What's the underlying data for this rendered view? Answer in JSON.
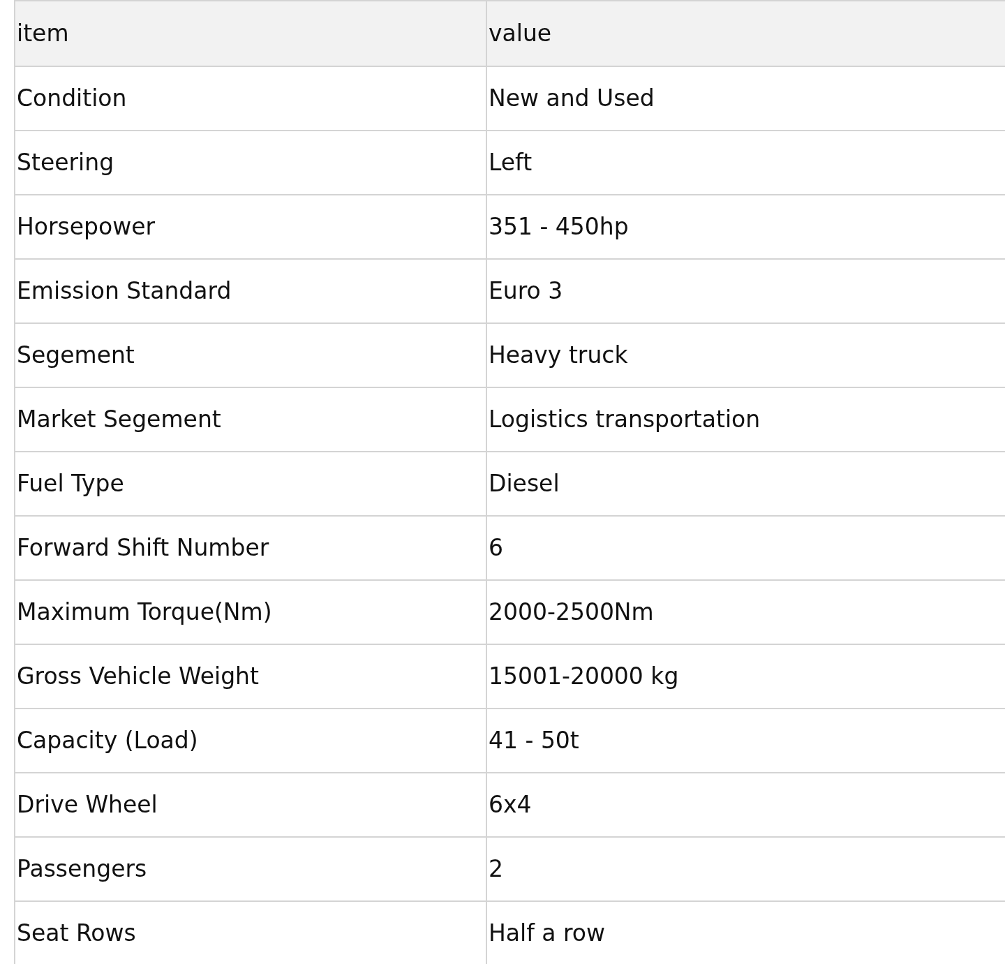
{
  "table": {
    "columns": [
      "item",
      "value"
    ],
    "rows": [
      [
        "Condition",
        "New and Used"
      ],
      [
        "Steering",
        "Left"
      ],
      [
        "Horsepower",
        "351 - 450hp"
      ],
      [
        "Emission Standard",
        "Euro 3"
      ],
      [
        "Segement",
        "Heavy truck"
      ],
      [
        "Market Segement",
        "Logistics transportation"
      ],
      [
        "Fuel Type",
        "Diesel"
      ],
      [
        "Forward Shift Number",
        "6"
      ],
      [
        "Maximum Torque(Nm)",
        "2000-2500Nm"
      ],
      [
        "Gross Vehicle Weight",
        "15001-20000 kg"
      ],
      [
        "Capacity (Load)",
        "41 - 50t"
      ],
      [
        "Drive Wheel",
        "6x4"
      ],
      [
        "Passengers",
        "2"
      ],
      [
        "Seat Rows",
        "Half a row"
      ]
    ]
  }
}
